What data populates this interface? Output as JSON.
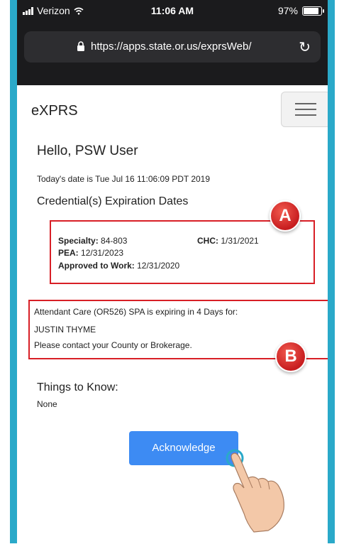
{
  "status_bar": {
    "carrier": "Verizon",
    "time": "11:06 AM",
    "battery": "97%",
    "battery_level": 0.97
  },
  "browser": {
    "url": "https://apps.state.or.us/exprsWeb/"
  },
  "header": {
    "brand": "eXPRS"
  },
  "main": {
    "greeting": "Hello, PSW User",
    "date_line": "Today's date is Tue Jul 16 11:06:09 PDT 2019",
    "credentials_title": "Credential(s) Expiration Dates",
    "credentials": {
      "specialty_label": "Specialty:",
      "specialty_value": "84-803",
      "chc_label": "CHC:",
      "chc_value": "1/31/2021",
      "pea_label": "PEA:",
      "pea_value": "12/31/2023",
      "approved_label": "Approved to Work:",
      "approved_value": "12/31/2020"
    },
    "alert": {
      "line1": "Attendant Care (OR526) SPA is expiring in 4 Days for:",
      "line2": "JUSTIN THYME",
      "line3": "Please contact your County or Brokerage."
    },
    "things_title": "Things to Know:",
    "things_value": "None",
    "acknowledge_label": "Acknowledge"
  },
  "callouts": {
    "a": "A",
    "b": "B"
  },
  "colors": {
    "frame": "#2aa9c9",
    "highlight": "#d81f26",
    "button": "#3d8bf3"
  }
}
